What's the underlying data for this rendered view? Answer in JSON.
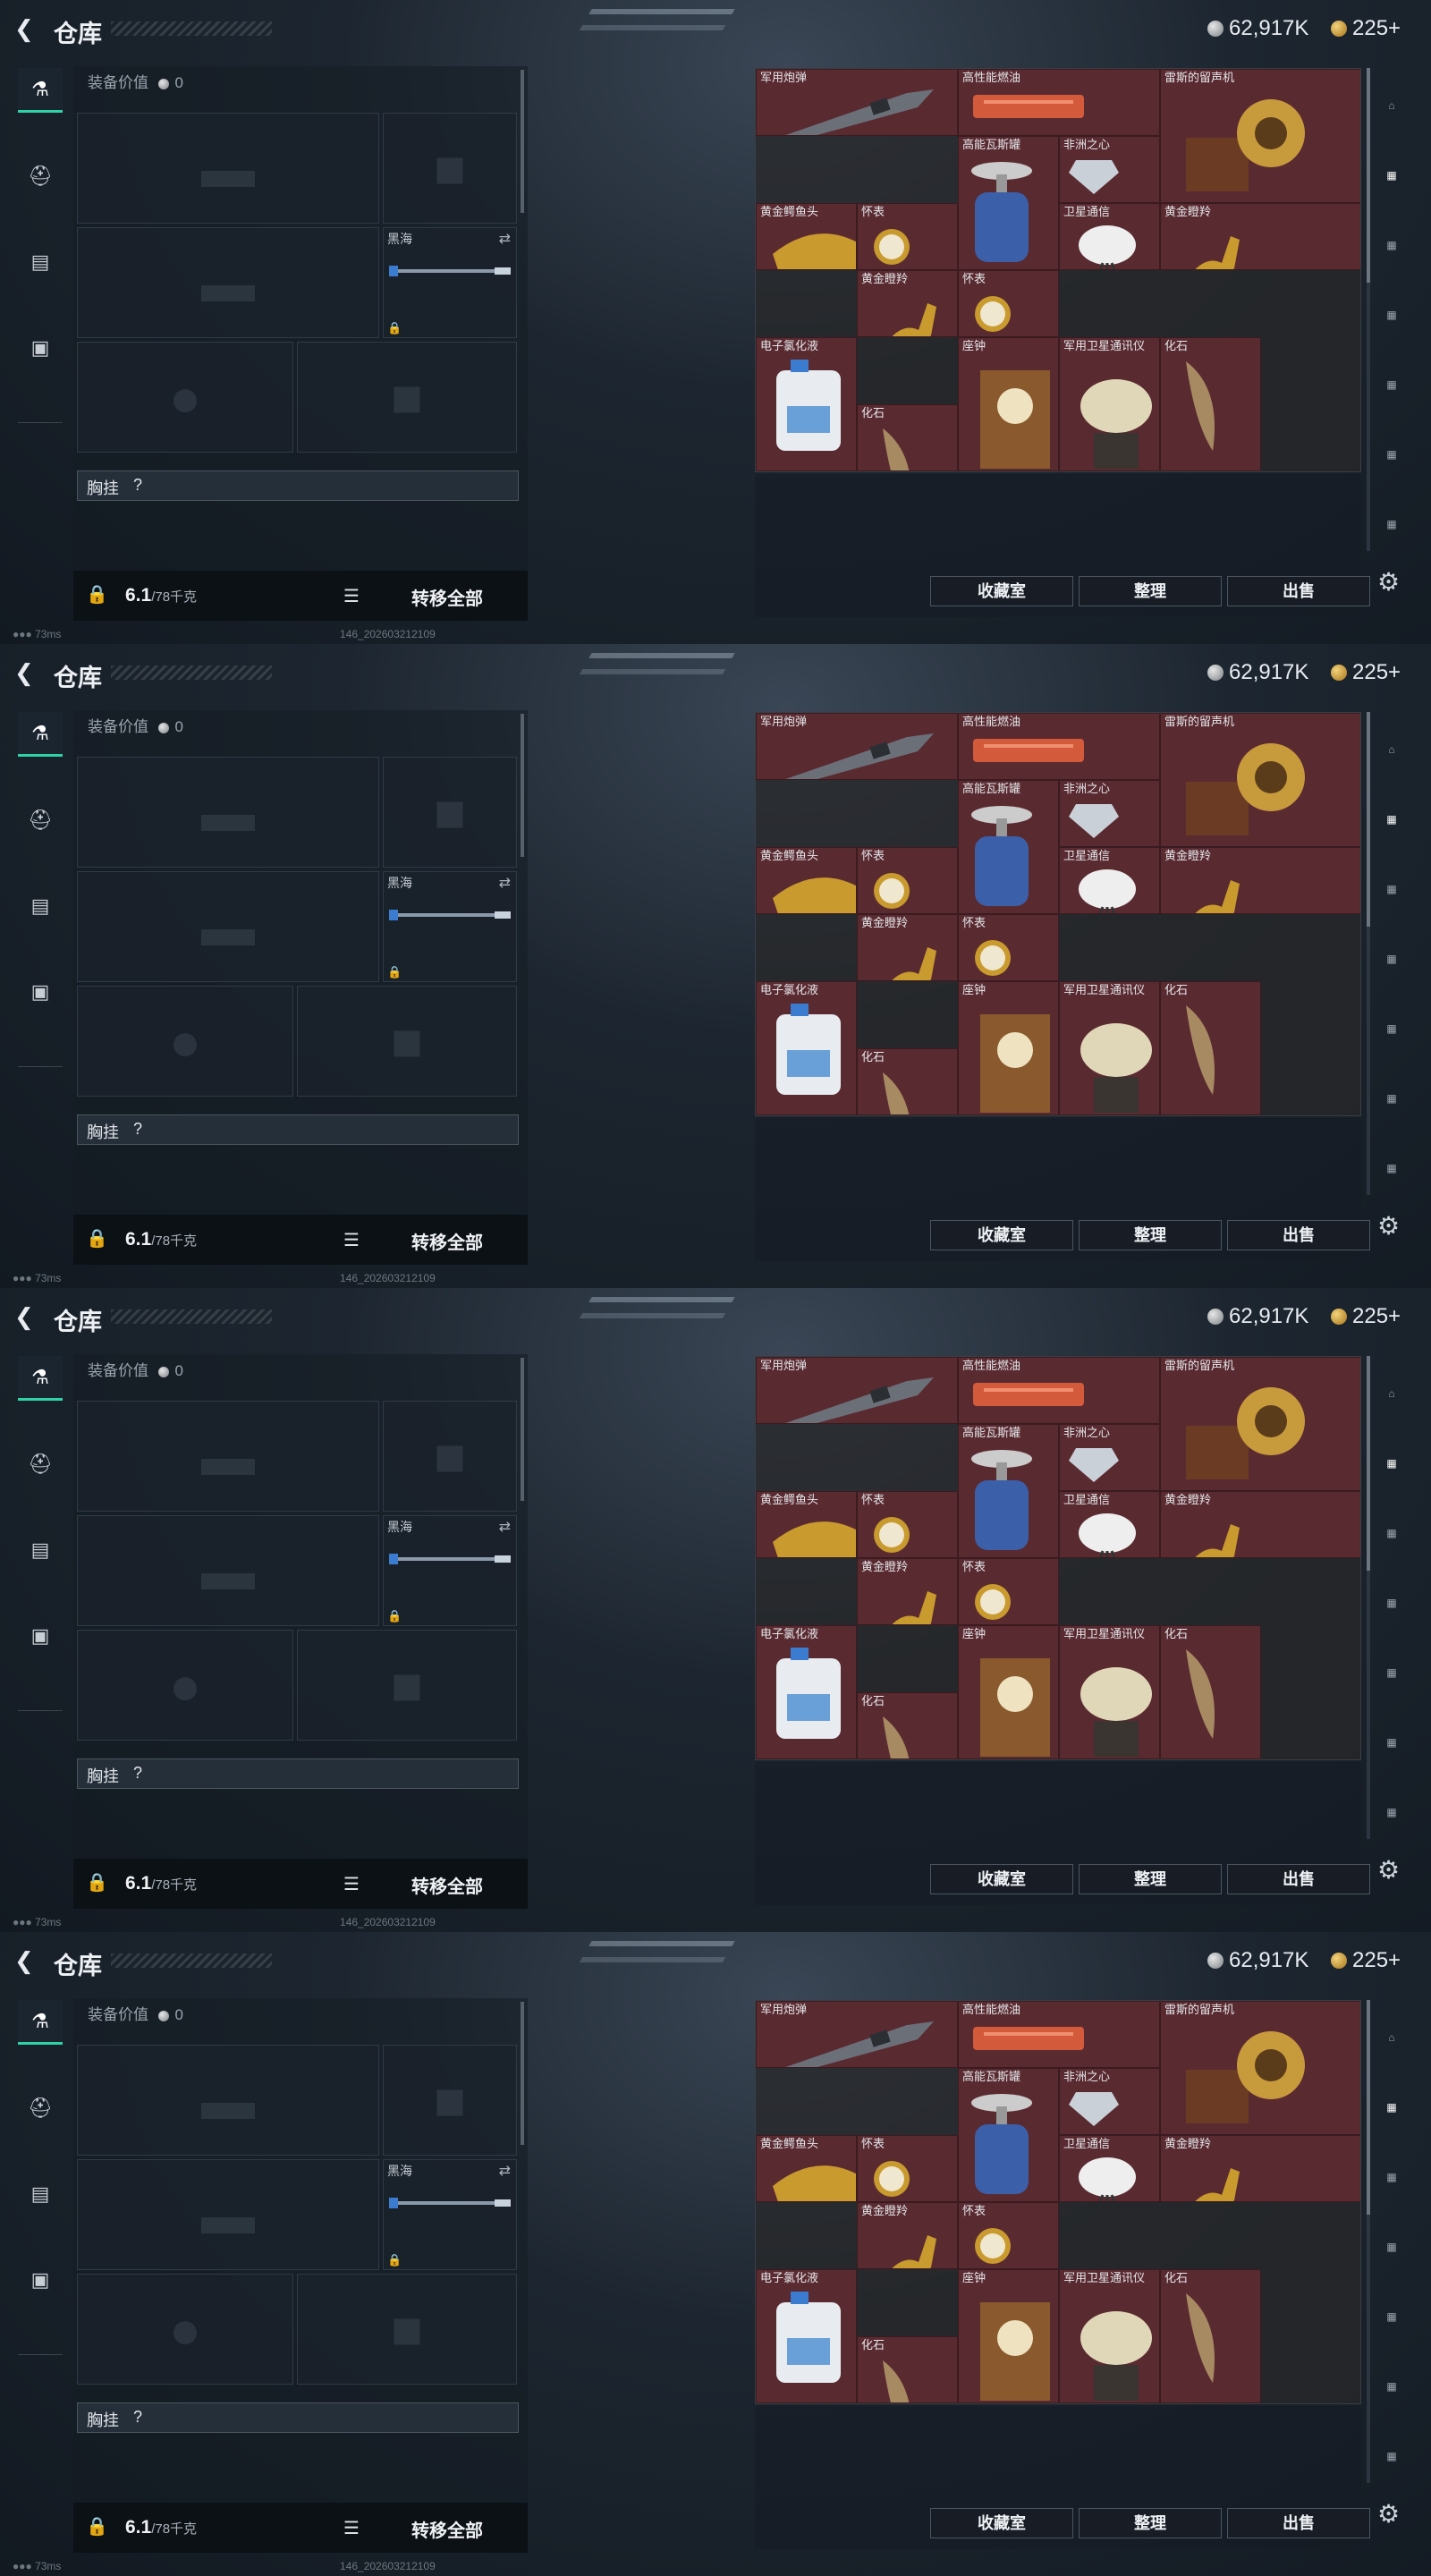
{
  "header": {
    "title": "仓库",
    "silver": "62,917K",
    "gold": "225+"
  },
  "equipment": {
    "value_label": "装备价值",
    "value": "0",
    "melee_label": "黑海",
    "chest_label": "胸挂",
    "chest_value": "?",
    "weight": "6.1",
    "weight_max": "/78千克",
    "transfer_all": "转移全部"
  },
  "actions": {
    "collection": "收藏室",
    "sort": "整理",
    "sell": "出售"
  },
  "status": {
    "ping": "73ms",
    "build": "146_202603212109"
  },
  "frames": [
    {
      "items": [
        {
          "name": "军用炮弹",
          "color": "red",
          "col": 0,
          "row": 0,
          "w": 2,
          "h": 1,
          "art": "shell"
        },
        {
          "name": "高性能燃油",
          "color": "red",
          "col": 2,
          "row": 0,
          "w": 2,
          "h": 1,
          "art": "fuel"
        },
        {
          "name": "雷斯的留声机",
          "color": "red",
          "col": 4,
          "row": 0,
          "w": 2,
          "h": 2,
          "art": "phono"
        },
        {
          "name": "高能瓦斯罐",
          "color": "red",
          "col": 2,
          "row": 1,
          "w": 1,
          "h": 2,
          "art": "gas"
        },
        {
          "name": "非洲之心",
          "color": "red",
          "col": 3,
          "row": 1,
          "w": 1,
          "h": 1,
          "art": "gem"
        },
        {
          "name": "黄金鳄鱼头",
          "color": "red",
          "col": 0,
          "row": 2,
          "w": 1,
          "h": 1,
          "art": "croc"
        },
        {
          "name": "怀表",
          "color": "red",
          "col": 1,
          "row": 2,
          "w": 1,
          "h": 1,
          "art": "watch"
        },
        {
          "name": "卫星通信",
          "color": "red",
          "col": 3,
          "row": 2,
          "w": 1,
          "h": 1,
          "art": "dish"
        },
        {
          "name": "黄金瞪羚",
          "color": "red",
          "col": 4,
          "row": 2,
          "w": 2,
          "h": 1,
          "art": "deer"
        },
        {
          "name": "黄金瞪羚",
          "color": "red",
          "col": 1,
          "row": 3,
          "w": 1,
          "h": 1,
          "art": "deer"
        },
        {
          "name": "怀表",
          "color": "red",
          "col": 2,
          "row": 3,
          "w": 1,
          "h": 1,
          "art": "watch"
        },
        {
          "name": "电子氯化液",
          "color": "red",
          "col": 0,
          "row": 4,
          "w": 1,
          "h": 2,
          "art": "jug"
        },
        {
          "name": "座钟",
          "color": "red",
          "col": 2,
          "row": 4,
          "w": 1,
          "h": 2,
          "art": "clock"
        },
        {
          "name": "军用卫星通讯仪",
          "color": "red",
          "col": 3,
          "row": 4,
          "w": 1,
          "h": 2,
          "art": "sat"
        },
        {
          "name": "化石",
          "color": "red",
          "col": 4,
          "row": 4,
          "w": 1,
          "h": 2,
          "art": "fossil"
        },
        {
          "name": "化石",
          "color": "red",
          "col": 1,
          "row": 5,
          "w": 1,
          "h": 1,
          "art": "fossil"
        }
      ]
    }
  ]
}
